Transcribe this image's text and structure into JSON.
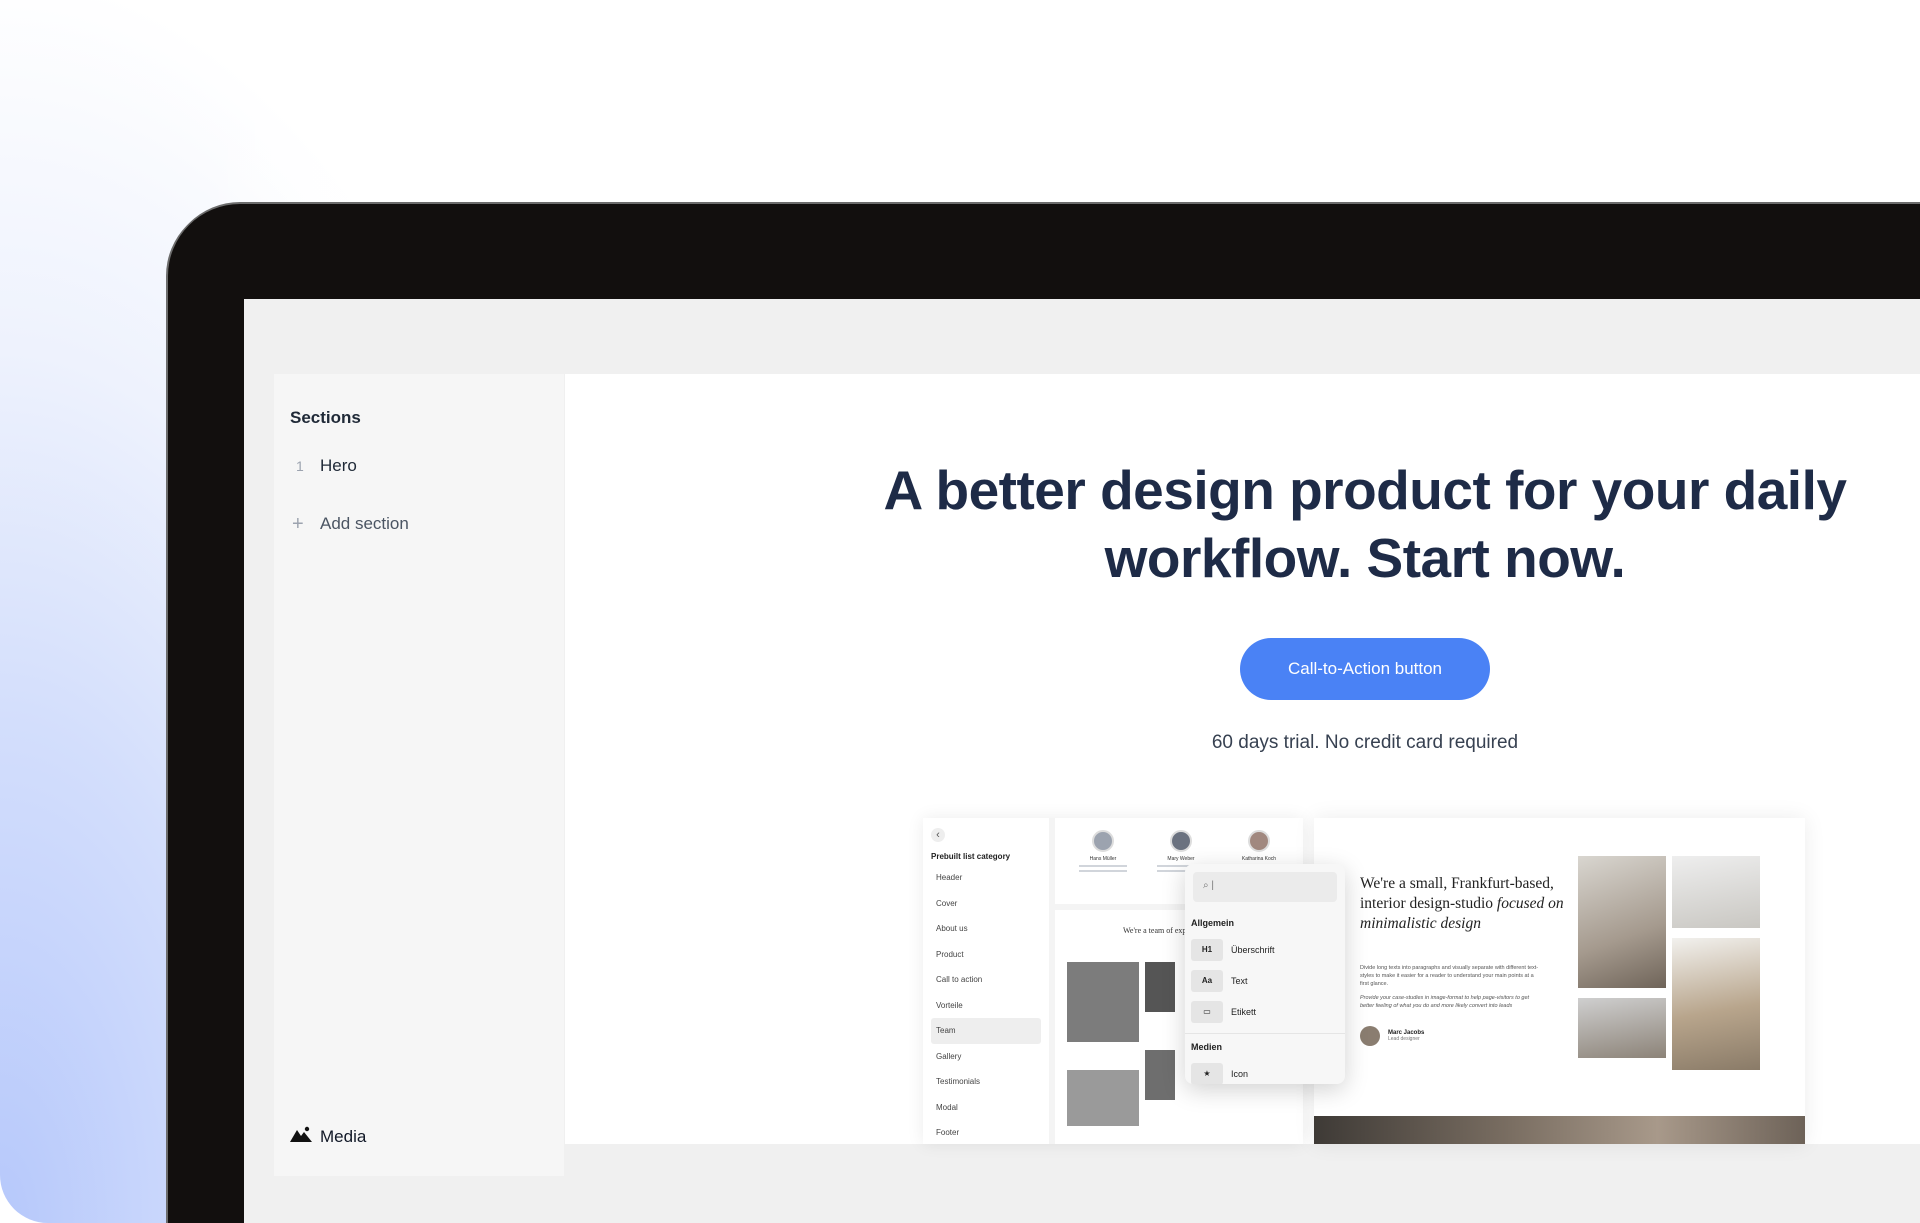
{
  "sidebar": {
    "title": "Sections",
    "sections": [
      {
        "index": "1",
        "label": "Hero"
      }
    ],
    "add_section_label": "Add section",
    "media_label": "Media"
  },
  "hero": {
    "headline_line1": "A better design product for your daily",
    "headline_line2": "workflow. Start now.",
    "cta_label": "Call-to-Action button",
    "subtext": "60 days trial. No credit card required"
  },
  "mockup": {
    "list_title": "Prebuilt list category",
    "list_items": [
      "Header",
      "Cover",
      "About us",
      "Product",
      "Call to action",
      "Vorteile",
      "Team",
      "Gallery",
      "Testimonials",
      "Modal",
      "Footer"
    ],
    "active_item": "Team",
    "team_people": [
      "Hans Müller",
      "Mary Weber",
      "Katharina Koch"
    ],
    "team_heading": "We're a team of exp",
    "popup": {
      "search_placeholder": "|",
      "group_general": "Allgemein",
      "items": [
        {
          "chip": "H1",
          "label": "Überschrift"
        },
        {
          "chip": "Aa",
          "label": "Text"
        },
        {
          "chip": "▭",
          "label": "Etikett"
        }
      ],
      "group_media": "Medien",
      "media_items": [
        {
          "chip": "★",
          "label": "Icon"
        }
      ]
    },
    "studio": {
      "heading_plain": "We're a small, Frankfurt-based, interior design-studio",
      "heading_italic": "focused on minimalistic design",
      "body1": "Divide long texts into paragraphs and visually separate with different text-styles to make it easier for a reader to understand your main points at a first glance.",
      "body2": "Provide your case-studies in image-format to help page-visitors to get better feeling of what you do and more likely convert into leads",
      "author_name": "Marc Jacobs",
      "author_role": "Lead designer"
    }
  },
  "colors": {
    "accent": "#4a82f5",
    "headline": "#1e2b47",
    "bezel": "#120f0e"
  }
}
